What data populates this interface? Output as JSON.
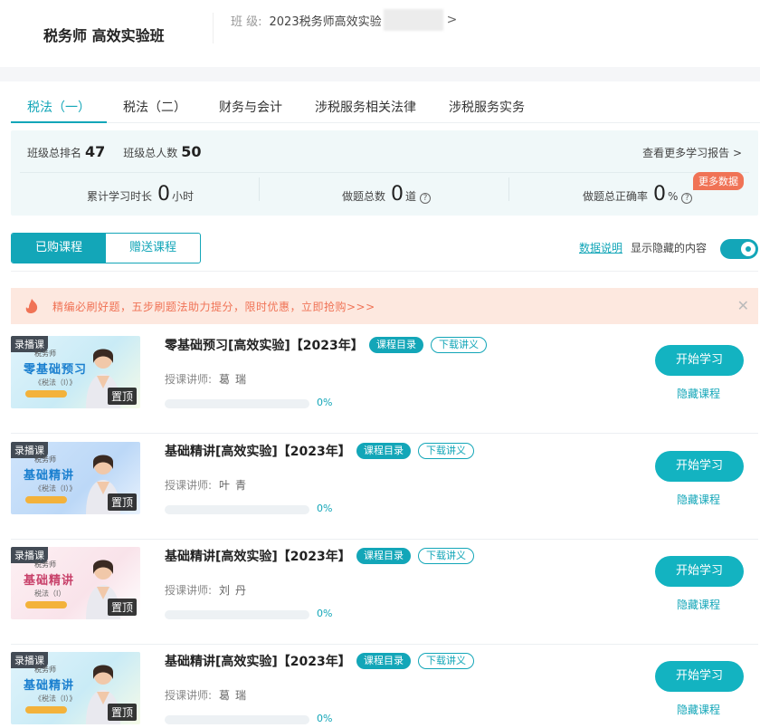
{
  "header": {
    "brand": "税务师 高效实验班",
    "class_label": "班    级:",
    "class_value": "2023税务师高效实验",
    "chevron": ">"
  },
  "tabs": [
    {
      "label": "税法（一）",
      "active": true
    },
    {
      "label": "税法（二）"
    },
    {
      "label": "财务与会计"
    },
    {
      "label": "涉税服务相关法律"
    },
    {
      "label": "涉税服务实务"
    }
  ],
  "stats": {
    "rank_label": "班级总排名",
    "rank_value": "47",
    "total_label": "班级总人数",
    "total_value": "50",
    "report_link": "查看更多学习报告 >",
    "study_time_label": "累计学习时长",
    "study_time_value": "0",
    "study_time_unit": "小时",
    "questions_label": "做题总数",
    "questions_value": "0",
    "questions_unit": "道",
    "accuracy_label": "做题总正确率",
    "accuracy_value": "0",
    "accuracy_unit": "%",
    "more_data_badge": "更多数据"
  },
  "filter": {
    "purchased": "已购课程",
    "gifted": "赠送课程",
    "data_explain": "数据说明",
    "show_hidden": "显示隐藏的内容",
    "toggle_on": true
  },
  "banner": {
    "text": "精编必刷好题，五步刷题法助力提分，限时优惠，立即抢购>>>",
    "close": "✕"
  },
  "colors": {
    "accent": "#13a6b8",
    "banner_text": "#f07356",
    "badge": "#f07356"
  },
  "common": {
    "catalog_btn": "课程目录",
    "download_btn": "下载讲义",
    "teacher_label": "授课讲师:",
    "start_btn": "开始学习",
    "hide_link": "隐藏课程",
    "rec_tag": "录播课",
    "pin_tag": "置顶",
    "thumb_sub": "税务师"
  },
  "courses": [
    {
      "title": "零基础预习[高效实验]【2023年】",
      "teacher": "葛瑞",
      "progress": 0,
      "progress_text": "0%",
      "thumb_title": "零基础预习",
      "thumb_tag": "《税法（Ⅰ）》"
    },
    {
      "title": "基础精讲[高效实验]【2023年】",
      "teacher": "叶青",
      "progress": 0,
      "progress_text": "0%",
      "thumb_title": "基础精讲",
      "thumb_tag": "《税法（Ⅰ）》"
    },
    {
      "title": "基础精讲[高效实验]【2023年】",
      "teacher": "刘丹",
      "progress": 0,
      "progress_text": "0%",
      "thumb_title": "基础精讲",
      "thumb_tag": "税法（Ⅰ）"
    },
    {
      "title": "基础精讲[高效实验]【2023年】",
      "teacher": "葛瑞",
      "progress": 0,
      "progress_text": "0%",
      "thumb_title": "基础精讲",
      "thumb_tag": "《税法（Ⅰ）》"
    }
  ]
}
